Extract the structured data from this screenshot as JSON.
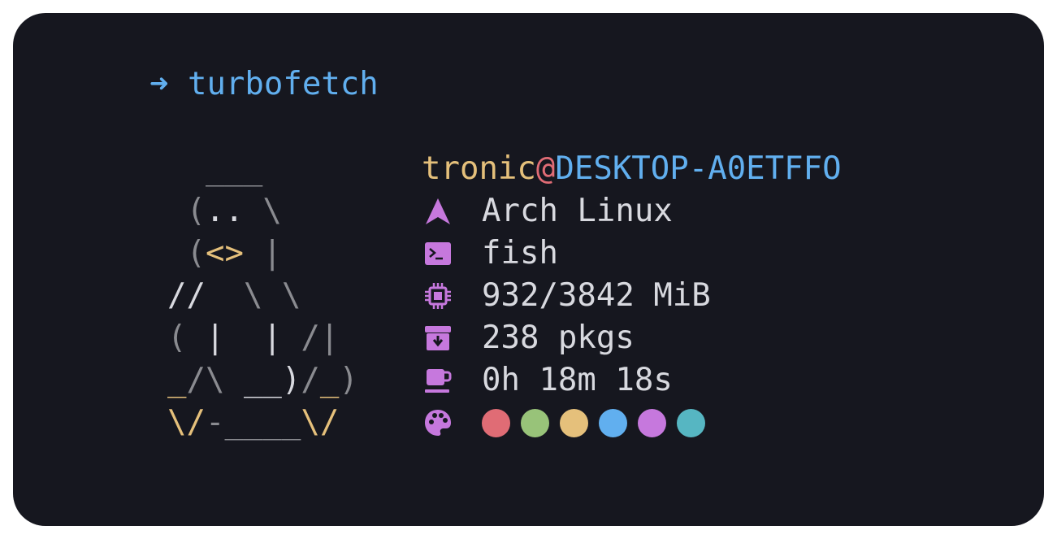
{
  "prompt": {
    "arrow": "➜",
    "command": "turbofetch"
  },
  "logo": {
    "lines": [
      "  ___",
      " (.. \\",
      " (<> |",
      "//  \\ \\",
      "( |  | /|",
      "_/\\ __)/_)",
      "\\/-____\\/"
    ]
  },
  "info": {
    "user": "tronic",
    "at": "@",
    "host": "DESKTOP-A0ETFFO",
    "os": {
      "icon": "arch-linux-icon",
      "value": "Arch Linux"
    },
    "shell": {
      "icon": "terminal-icon",
      "value": "fish"
    },
    "memory": {
      "icon": "chip-icon",
      "value": "932/3842 MiB"
    },
    "packages": {
      "icon": "archive-box-icon",
      "value": "238 pkgs"
    },
    "uptime": {
      "icon": "coffee-cup-icon",
      "value": "0h 18m 18s"
    },
    "colors": {
      "icon": "palette-icon",
      "swatches": [
        "#e06c75",
        "#98c379",
        "#e5c07b",
        "#61afef",
        "#c678dd",
        "#56b6c2"
      ]
    }
  },
  "theme": {
    "background": "#16171f",
    "text": "#d8d9df",
    "icon_color": "#c678dd",
    "logo_gray": "#8a8b90",
    "logo_yellow": "#e5c07b"
  }
}
